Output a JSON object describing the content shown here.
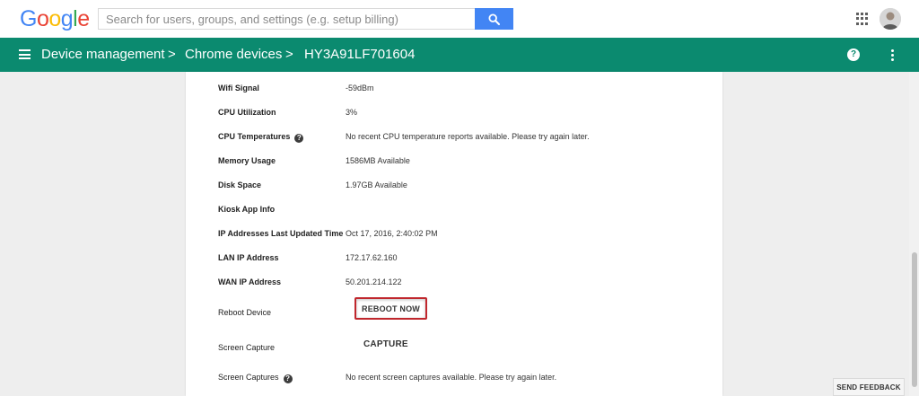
{
  "header": {
    "logo_letters": [
      {
        "char": "G",
        "color": "#4285F4"
      },
      {
        "char": "o",
        "color": "#EA4335"
      },
      {
        "char": "o",
        "color": "#FBBC05"
      },
      {
        "char": "g",
        "color": "#4285F4"
      },
      {
        "char": "l",
        "color": "#34A853"
      },
      {
        "char": "e",
        "color": "#EA4335"
      }
    ],
    "search": {
      "placeholder": "Search for users, groups, and settings (e.g. setup billing)",
      "value": ""
    },
    "icons": {
      "search": "search-icon",
      "apps": "apps-grid-icon",
      "avatar": "user-avatar"
    }
  },
  "nav": {
    "breadcrumbs": [
      "Device management",
      "Chrome devices",
      "HY3A91LF701604"
    ],
    "separator": ">",
    "help_label": "?",
    "color": "#0B8A6F"
  },
  "details": [
    {
      "label": "Wifi Signal",
      "value": "-59dBm",
      "help": false
    },
    {
      "label": "CPU Utilization",
      "value": "3%",
      "help": false
    },
    {
      "label": "CPU Temperatures",
      "value": "No recent CPU temperature reports available. Please try again later.",
      "help": true
    },
    {
      "label": "Memory Usage",
      "value": "1586MB Available",
      "help": false
    },
    {
      "label": "Disk Space",
      "value": "1.97GB Available",
      "help": false
    },
    {
      "label": "Kiosk App Info",
      "value": "",
      "help": false
    },
    {
      "label": "IP Addresses Last Updated Time",
      "value": "Oct 17, 2016, 2:40:02 PM",
      "help": false
    },
    {
      "label": "LAN IP Address",
      "value": "172.17.62.160",
      "help": false
    },
    {
      "label": "WAN IP Address",
      "value": "50.201.214.122",
      "help": false
    }
  ],
  "actions": {
    "reboot_label": "Reboot Device",
    "reboot_button": "REBOOT NOW",
    "capture_label": "Screen Capture",
    "capture_button": "CAPTURE",
    "captures_label": "Screen Captures",
    "captures_value": "No recent screen captures available. Please try again later.",
    "help_glyph": "?"
  },
  "footer": {
    "feedback_button": "SEND FEEDBACK"
  },
  "colors": {
    "brand_green": "#0B8A6F",
    "search_blue": "#4285F4",
    "highlight_red": "#C0272D"
  }
}
